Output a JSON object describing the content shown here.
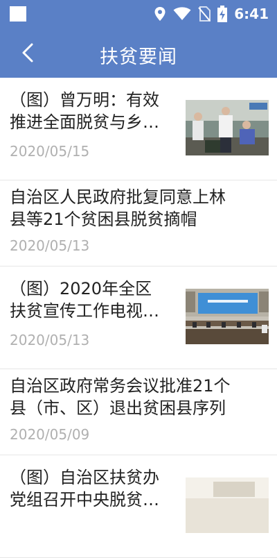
{
  "status_bar": {
    "time": "6:41",
    "icons": [
      "location-icon",
      "wifi-icon",
      "no-sim-icon",
      "battery-charging-icon"
    ]
  },
  "header": {
    "title": "扶贫要闻",
    "back_icon": "back-arrow-icon"
  },
  "colors": {
    "primary": "#5a80c6",
    "title_text": "#222222",
    "date_text": "#b0b0b0"
  },
  "news": [
    {
      "line1": "（图）曾万明：有效",
      "line2": "推进全面脱贫与乡…",
      "date": "2020/05/15",
      "has_thumb": true
    },
    {
      "line1": "自治区人民政府批复同意上林",
      "line2": "县等21个贫困县脱贫摘帽",
      "date": "2020/05/13",
      "has_thumb": false
    },
    {
      "line1": "（图）2020年全区",
      "line2": "扶贫宣传工作电视…",
      "date": "2020/05/13",
      "has_thumb": true
    },
    {
      "line1": "自治区政府常务会议批准21个",
      "line2": "县（市、区）退出贫困县序列",
      "date": "2020/05/09",
      "has_thumb": false
    },
    {
      "line1": "（图）自治区扶贫办",
      "line2": "党组召开中央脱贫…",
      "date": "",
      "has_thumb": true
    }
  ]
}
